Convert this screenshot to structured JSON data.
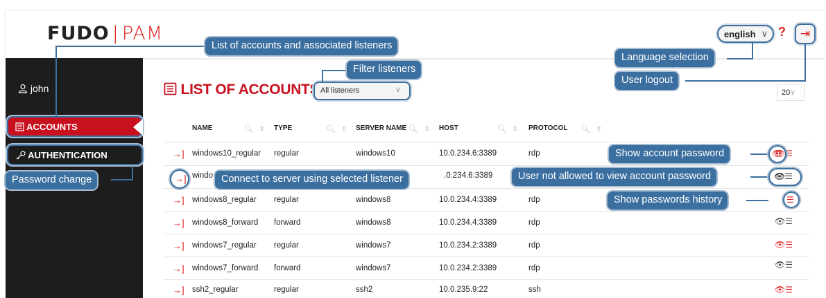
{
  "header": {
    "logo_main": "FUDO",
    "logo_sep": "|",
    "logo_sub": "PAM",
    "language": "english",
    "language_chevron": "∨",
    "help_icon": "?",
    "logout_icon": "⇥"
  },
  "sidebar": {
    "user_icon": "user-icon",
    "user_name": "john",
    "items": [
      {
        "icon": "list-icon",
        "label": "ACCOUNTS",
        "active": true
      },
      {
        "icon": "key-icon",
        "label": "AUTHENTICATION",
        "active": false
      }
    ]
  },
  "main": {
    "title": "LIST OF ACCOUNTS",
    "filter": "All listeners",
    "page_size": "20",
    "columns": [
      "NAME",
      "TYPE",
      "SERVER NAME",
      "HOST",
      "PROTOCOL"
    ],
    "rows": [
      {
        "name": "windows10_regular",
        "type": "regular",
        "server": "windows10",
        "host": "10.0.234.6:3389",
        "protocol": "rdp",
        "password_visible": true
      },
      {
        "name": "windo",
        "type": "",
        "server": "",
        "host": ".0.234.6:3389",
        "protocol": "",
        "password_visible": false
      },
      {
        "name": "windows8_regular",
        "type": "regular",
        "server": "windows8",
        "host": "10.0.234.4:3389",
        "protocol": "rdp",
        "password_visible": true
      },
      {
        "name": "windows8_forward",
        "type": "forward",
        "server": "windows8",
        "host": "10.0.234.4:3389",
        "protocol": "rdp",
        "password_visible": false
      },
      {
        "name": "windows7_regular",
        "type": "regular",
        "server": "windows7",
        "host": "10.0.234.2:3389",
        "protocol": "rdp",
        "password_visible": true
      },
      {
        "name": "windows7_forward",
        "type": "forward",
        "server": "windows7",
        "host": "10.0.234.2:3389",
        "protocol": "rdp",
        "password_visible": false
      },
      {
        "name": "ssh2_regular",
        "type": "regular",
        "server": "ssh2",
        "host": "10.0.235.9:22",
        "protocol": "ssh",
        "password_visible": true
      }
    ]
  },
  "callouts": {
    "accounts_list": "List of accounts and associated listeners",
    "filter": "Filter listeners",
    "language": "Language selection",
    "logout": "User logout",
    "password_change": "Password change",
    "connect": "Connect to server using selected listener",
    "show_password": "Show account password",
    "not_allowed": "User not allowed to view account password",
    "history": "Show passwords history"
  },
  "colors": {
    "accent": "#c8101e",
    "callout": "#3b6fa0",
    "sidebar": "#1d1d1d"
  }
}
